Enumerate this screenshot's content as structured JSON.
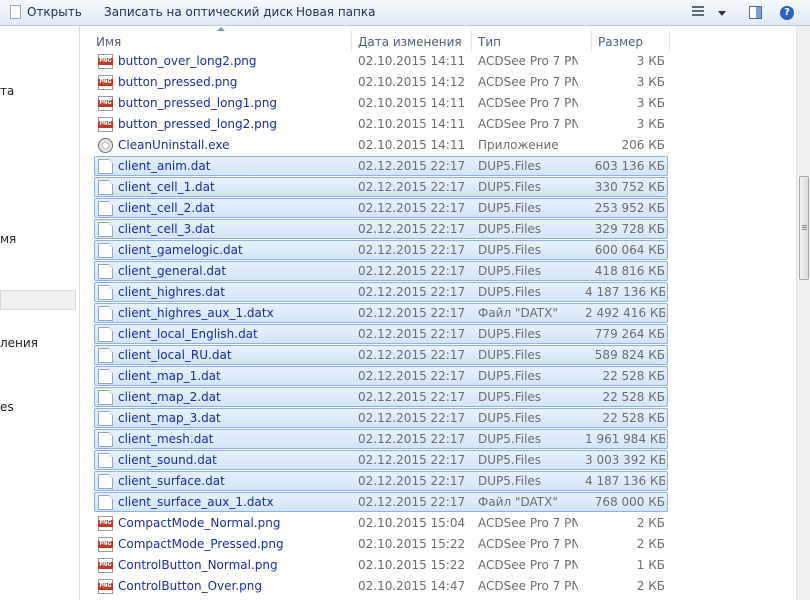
{
  "toolbar": {
    "open_label": "Открыть",
    "burn_label": "Записать на оптический диск",
    "new_folder_label": "Новая папка"
  },
  "nav": {
    "fragments": [
      "та",
      "мя",
      "ления",
      "es"
    ]
  },
  "columns": {
    "name": "Имя",
    "date": "Дата изменения",
    "type": "Тип",
    "size": "Размер"
  },
  "files": [
    {
      "name": "button_over_long2.png",
      "date": "02.10.2015 14:11",
      "type": "ACDSee Pro 7 PN...",
      "size": "3 КБ",
      "icon": "png-file-icon",
      "selected": false
    },
    {
      "name": "button_pressed.png",
      "date": "02.10.2015 14:12",
      "type": "ACDSee Pro 7 PN...",
      "size": "3 КБ",
      "icon": "png-file-icon",
      "selected": false
    },
    {
      "name": "button_pressed_long1.png",
      "date": "02.10.2015 14:11",
      "type": "ACDSee Pro 7 PN...",
      "size": "3 КБ",
      "icon": "png-file-icon",
      "selected": false
    },
    {
      "name": "button_pressed_long2.png",
      "date": "02.10.2015 14:11",
      "type": "ACDSee Pro 7 PN...",
      "size": "3 КБ",
      "icon": "png-file-icon",
      "selected": false
    },
    {
      "name": "CleanUninstall.exe",
      "date": "02.10.2015 14:11",
      "type": "Приложение",
      "size": "206 КБ",
      "icon": "exe-file-icon",
      "selected": false
    },
    {
      "name": "client_anim.dat",
      "date": "02.12.2015 22:17",
      "type": "DUP5.Files",
      "size": "603 136 КБ",
      "icon": "dat-file-icon",
      "selected": true
    },
    {
      "name": "client_cell_1.dat",
      "date": "02.12.2015 22:17",
      "type": "DUP5.Files",
      "size": "330 752 КБ",
      "icon": "dat-file-icon",
      "selected": true
    },
    {
      "name": "client_cell_2.dat",
      "date": "02.12.2015 22:17",
      "type": "DUP5.Files",
      "size": "253 952 КБ",
      "icon": "dat-file-icon",
      "selected": true
    },
    {
      "name": "client_cell_3.dat",
      "date": "02.12.2015 22:17",
      "type": "DUP5.Files",
      "size": "329 728 КБ",
      "icon": "dat-file-icon",
      "selected": true
    },
    {
      "name": "client_gamelogic.dat",
      "date": "02.12.2015 22:17",
      "type": "DUP5.Files",
      "size": "600 064 КБ",
      "icon": "dat-file-icon",
      "selected": true
    },
    {
      "name": "client_general.dat",
      "date": "02.12.2015 22:17",
      "type": "DUP5.Files",
      "size": "418 816 КБ",
      "icon": "dat-file-icon",
      "selected": true
    },
    {
      "name": "client_highres.dat",
      "date": "02.12.2015 22:17",
      "type": "DUP5.Files",
      "size": "4 187 136 КБ",
      "icon": "dat-file-icon",
      "selected": true
    },
    {
      "name": "client_highres_aux_1.datx",
      "date": "02.12.2015 22:17",
      "type": "Файл \"DATX\"",
      "size": "2 492 416 КБ",
      "icon": "dat-file-icon",
      "selected": true
    },
    {
      "name": "client_local_English.dat",
      "date": "02.12.2015 22:17",
      "type": "DUP5.Files",
      "size": "779 264 КБ",
      "icon": "dat-file-icon",
      "selected": true
    },
    {
      "name": "client_local_RU.dat",
      "date": "02.12.2015 22:17",
      "type": "DUP5.Files",
      "size": "589 824 КБ",
      "icon": "dat-file-icon",
      "selected": true
    },
    {
      "name": "client_map_1.dat",
      "date": "02.12.2015 22:17",
      "type": "DUP5.Files",
      "size": "22 528 КБ",
      "icon": "dat-file-icon",
      "selected": true
    },
    {
      "name": "client_map_2.dat",
      "date": "02.12.2015 22:17",
      "type": "DUP5.Files",
      "size": "22 528 КБ",
      "icon": "dat-file-icon",
      "selected": true
    },
    {
      "name": "client_map_3.dat",
      "date": "02.12.2015 22:17",
      "type": "DUP5.Files",
      "size": "22 528 КБ",
      "icon": "dat-file-icon",
      "selected": true
    },
    {
      "name": "client_mesh.dat",
      "date": "02.12.2015 22:17",
      "type": "DUP5.Files",
      "size": "1 961 984 КБ",
      "icon": "dat-file-icon",
      "selected": true
    },
    {
      "name": "client_sound.dat",
      "date": "02.12.2015 22:17",
      "type": "DUP5.Files",
      "size": "3 003 392 КБ",
      "icon": "dat-file-icon",
      "selected": true
    },
    {
      "name": "client_surface.dat",
      "date": "02.12.2015 22:17",
      "type": "DUP5.Files",
      "size": "4 187 136 КБ",
      "icon": "dat-file-icon",
      "selected": true
    },
    {
      "name": "client_surface_aux_1.datx",
      "date": "02.12.2015 22:17",
      "type": "Файл \"DATX\"",
      "size": "768 000 КБ",
      "icon": "dat-file-icon",
      "selected": true
    },
    {
      "name": "CompactMode_Normal.png",
      "date": "02.10.2015 15:04",
      "type": "ACDSee Pro 7 PN...",
      "size": "2 КБ",
      "icon": "png-file-icon",
      "selected": false
    },
    {
      "name": "CompactMode_Pressed.png",
      "date": "02.10.2015 15:22",
      "type": "ACDSee Pro 7 PN...",
      "size": "2 КБ",
      "icon": "png-file-icon",
      "selected": false
    },
    {
      "name": "ControlButton_Normal.png",
      "date": "02.10.2015 15:22",
      "type": "ACDSee Pro 7 PN...",
      "size": "1 КБ",
      "icon": "png-file-icon",
      "selected": false
    },
    {
      "name": "ControlButton_Over.png",
      "date": "02.10.2015 14:47",
      "type": "ACDSee Pro 7 PN...",
      "size": "2 КБ",
      "icon": "png-file-icon",
      "selected": false
    }
  ]
}
